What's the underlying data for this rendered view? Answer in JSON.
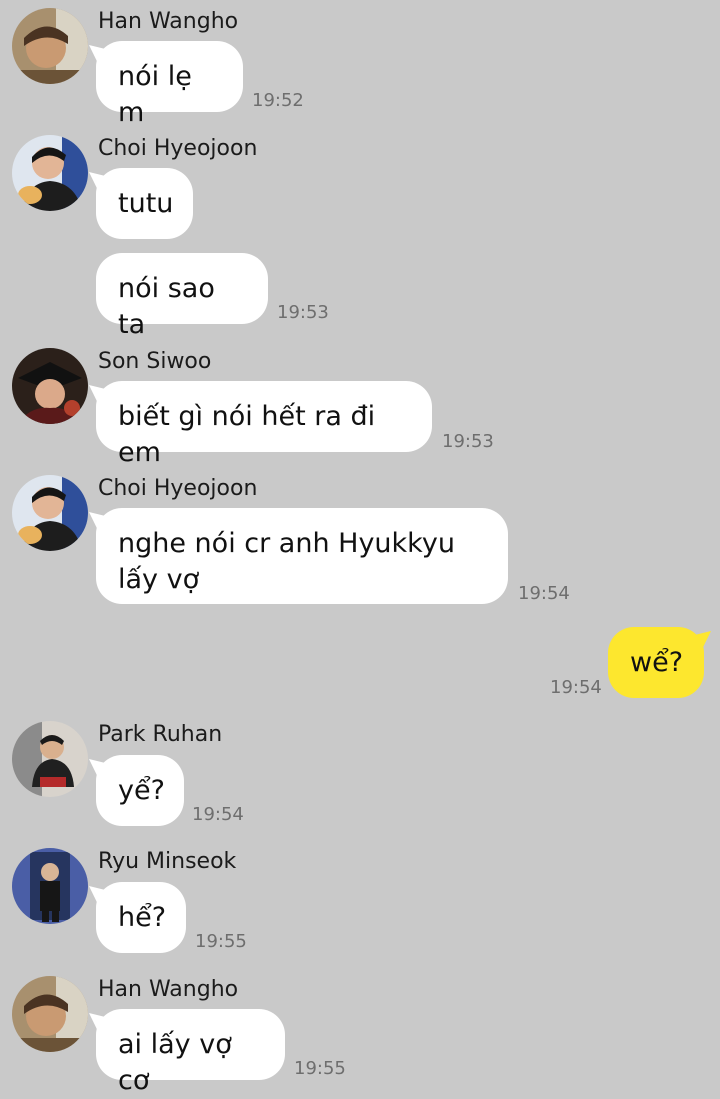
{
  "colors": {
    "background": "#c9c9c9",
    "incoming_bubble": "#ffffff",
    "outgoing_bubble": "#fde72e",
    "timestamp": "#6e6e6e"
  },
  "messages": [
    {
      "sender": "Han Wangho",
      "avatar": "avatar-han-wangho",
      "text": "nói lẹ m",
      "time": "19:52"
    },
    {
      "sender": "Choi Hyeojoon",
      "avatar": "avatar-choi-hyeojoon",
      "text": "tutu",
      "time": ""
    },
    {
      "sender": "",
      "avatar": "",
      "text": "nói sao ta",
      "time": "19:53"
    },
    {
      "sender": "Son Siwoo",
      "avatar": "avatar-son-siwoo",
      "text": "biết gì nói hết ra đi em",
      "time": "19:53"
    },
    {
      "sender": "Choi Hyeojoon",
      "avatar": "avatar-choi-hyeojoon",
      "text": "nghe nói cr anh Hyukkyu lấy vợ",
      "time": "19:54"
    },
    {
      "sender": "me",
      "avatar": "",
      "text": "wể?",
      "time": "19:54"
    },
    {
      "sender": "Park Ruhan",
      "avatar": "avatar-park-ruhan",
      "text": "yể?",
      "time": "19:54"
    },
    {
      "sender": "Ryu Minseok",
      "avatar": "avatar-ryu-minseok",
      "text": "hể?",
      "time": "19:55"
    },
    {
      "sender": "Han Wangho",
      "avatar": "avatar-han-wangho",
      "text": "ai lấy vợ cơ",
      "time": "19:55"
    }
  ]
}
